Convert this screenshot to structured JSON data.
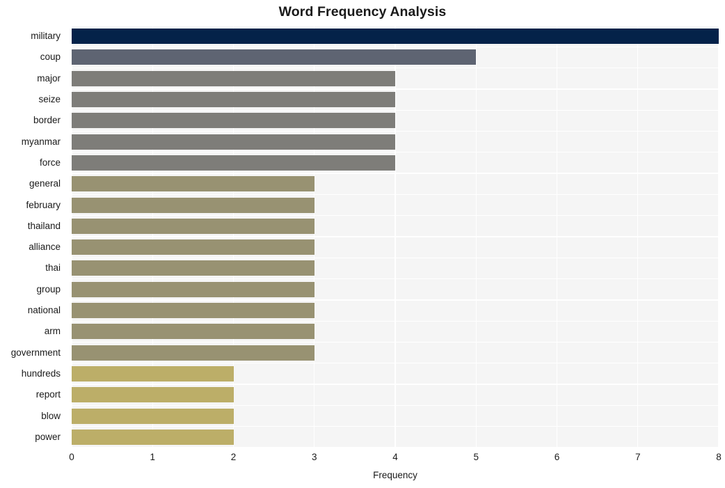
{
  "chart_data": {
    "type": "bar",
    "orientation": "horizontal",
    "title": "Word Frequency Analysis",
    "xlabel": "Frequency",
    "ylabel": "",
    "xlim": [
      0,
      8
    ],
    "xticks": [
      "0",
      "1",
      "2",
      "3",
      "4",
      "5",
      "6",
      "7",
      "8"
    ],
    "grid": true,
    "legend": "none",
    "categories": [
      "military",
      "coup",
      "major",
      "seize",
      "border",
      "myanmar",
      "force",
      "general",
      "february",
      "thailand",
      "alliance",
      "thai",
      "group",
      "national",
      "arm",
      "government",
      "hundreds",
      "report",
      "blow",
      "power"
    ],
    "values": [
      8,
      5,
      4,
      4,
      4,
      4,
      4,
      3,
      3,
      3,
      3,
      3,
      3,
      3,
      3,
      3,
      2,
      2,
      2,
      2
    ],
    "bar_colors": [
      "#042249",
      "#5e6472",
      "#7e7d79",
      "#7e7d79",
      "#7e7d79",
      "#7e7d79",
      "#7e7d79",
      "#989272",
      "#989272",
      "#989272",
      "#989272",
      "#989272",
      "#989272",
      "#989272",
      "#989272",
      "#989272",
      "#bcae68",
      "#bcae68",
      "#bcae68",
      "#bcae68"
    ]
  },
  "style": {
    "plot_background": "#f5f5f5",
    "gridline_color": "#ffffff",
    "text_color": "#1a1a1a",
    "figure_background": "#ffffff"
  }
}
